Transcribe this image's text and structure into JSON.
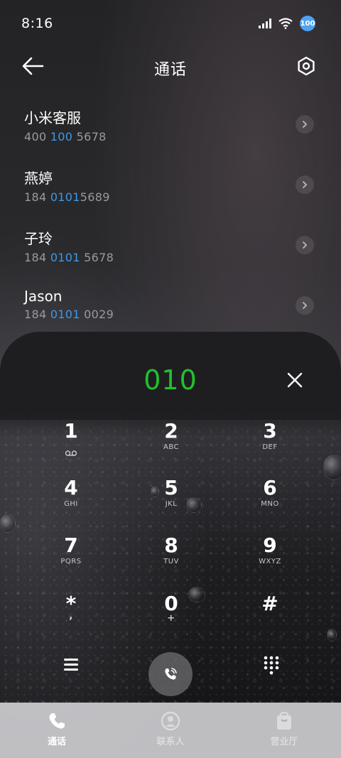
{
  "status_bar": {
    "time": "8:16",
    "battery": "100"
  },
  "header": {
    "title": "通话"
  },
  "contacts": [
    {
      "name": "小米客服",
      "number_parts": [
        "400 ",
        "100",
        " 5678"
      ]
    },
    {
      "name": "燕婷",
      "number_parts": [
        "184 ",
        "0101",
        "5689"
      ]
    },
    {
      "name": "子玲",
      "number_parts": [
        "184 ",
        "0101",
        " 5678"
      ]
    },
    {
      "name": "Jason",
      "number_parts": [
        "184 ",
        "0101",
        " 0029"
      ]
    }
  ],
  "dialer": {
    "input": "010",
    "keys": [
      {
        "digit": "1",
        "letters": "voicemail-icon"
      },
      {
        "digit": "2",
        "letters": "ABC"
      },
      {
        "digit": "3",
        "letters": "DEF"
      },
      {
        "digit": "4",
        "letters": "GHI"
      },
      {
        "digit": "5",
        "letters": "JKL"
      },
      {
        "digit": "6",
        "letters": "MNO"
      },
      {
        "digit": "7",
        "letters": "PQRS"
      },
      {
        "digit": "8",
        "letters": "TUV"
      },
      {
        "digit": "9",
        "letters": "WXYZ"
      },
      {
        "digit": "*",
        "letters": ","
      },
      {
        "digit": "0",
        "letters": "+"
      },
      {
        "digit": "#",
        "letters": ""
      }
    ]
  },
  "tabs": [
    {
      "label": "通话",
      "icon": "phone-icon",
      "active": true
    },
    {
      "label": "联系人",
      "icon": "contacts-icon",
      "active": false
    },
    {
      "label": "营业厅",
      "icon": "store-icon",
      "active": false
    }
  ],
  "colors": {
    "accent_green": "#22c02d",
    "highlight_blue": "#3d98e8"
  }
}
